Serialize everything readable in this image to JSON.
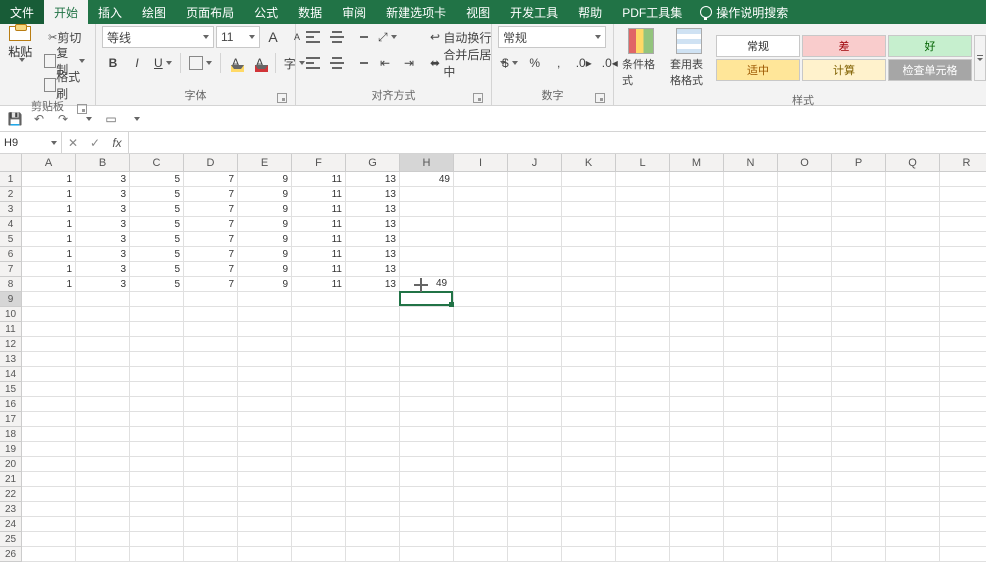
{
  "tabs": {
    "file": "文件",
    "items": [
      "开始",
      "插入",
      "绘图",
      "页面布局",
      "公式",
      "数据",
      "审阅",
      "新建选项卡",
      "视图",
      "开发工具",
      "帮助",
      "PDF工具集"
    ],
    "active_index": 0,
    "search_placeholder": "操作说明搜索"
  },
  "clipboard": {
    "paste": "粘贴",
    "cut": "剪切",
    "copy": "复制",
    "painter": "格式刷",
    "group": "剪贴板"
  },
  "font": {
    "name": "等线",
    "size": "11",
    "bold": "B",
    "italic": "I",
    "under": "U",
    "group": "字体"
  },
  "align": {
    "wrap": "自动换行",
    "merge": "合并后居中",
    "group": "对齐方式"
  },
  "number": {
    "format": "常规",
    "group": "数字"
  },
  "styles": {
    "cond": "条件格式",
    "tbl": "套用表格格式",
    "normal": "常规",
    "bad": "差",
    "good": "好",
    "neutral": "适中",
    "calc": "计算",
    "check": "检查单元格",
    "group": "样式"
  },
  "namebox": "H9",
  "formula": "",
  "columns": [
    "A",
    "B",
    "C",
    "D",
    "E",
    "F",
    "G",
    "H",
    "I",
    "J",
    "K",
    "L",
    "M",
    "N",
    "O",
    "P",
    "Q",
    "R"
  ],
  "row_count": 26,
  "active": {
    "row": 9,
    "col": "H"
  },
  "cursor_overlay": {
    "row": 8,
    "col": "H",
    "value": "49"
  },
  "chart_data": {
    "type": "table",
    "columns": [
      "A",
      "B",
      "C",
      "D",
      "E",
      "F",
      "G",
      "H"
    ],
    "rows": [
      {
        "A": 1,
        "B": 3,
        "C": 5,
        "D": 7,
        "E": 9,
        "F": 11,
        "G": 13,
        "H": 49
      },
      {
        "A": 1,
        "B": 3,
        "C": 5,
        "D": 7,
        "E": 9,
        "F": 11,
        "G": 13
      },
      {
        "A": 1,
        "B": 3,
        "C": 5,
        "D": 7,
        "E": 9,
        "F": 11,
        "G": 13
      },
      {
        "A": 1,
        "B": 3,
        "C": 5,
        "D": 7,
        "E": 9,
        "F": 11,
        "G": 13
      },
      {
        "A": 1,
        "B": 3,
        "C": 5,
        "D": 7,
        "E": 9,
        "F": 11,
        "G": 13
      },
      {
        "A": 1,
        "B": 3,
        "C": 5,
        "D": 7,
        "E": 9,
        "F": 11,
        "G": 13
      },
      {
        "A": 1,
        "B": 3,
        "C": 5,
        "D": 7,
        "E": 9,
        "F": 11,
        "G": 13
      },
      {
        "A": 1,
        "B": 3,
        "C": 5,
        "D": 7,
        "E": 9,
        "F": 11,
        "G": 13
      }
    ]
  }
}
